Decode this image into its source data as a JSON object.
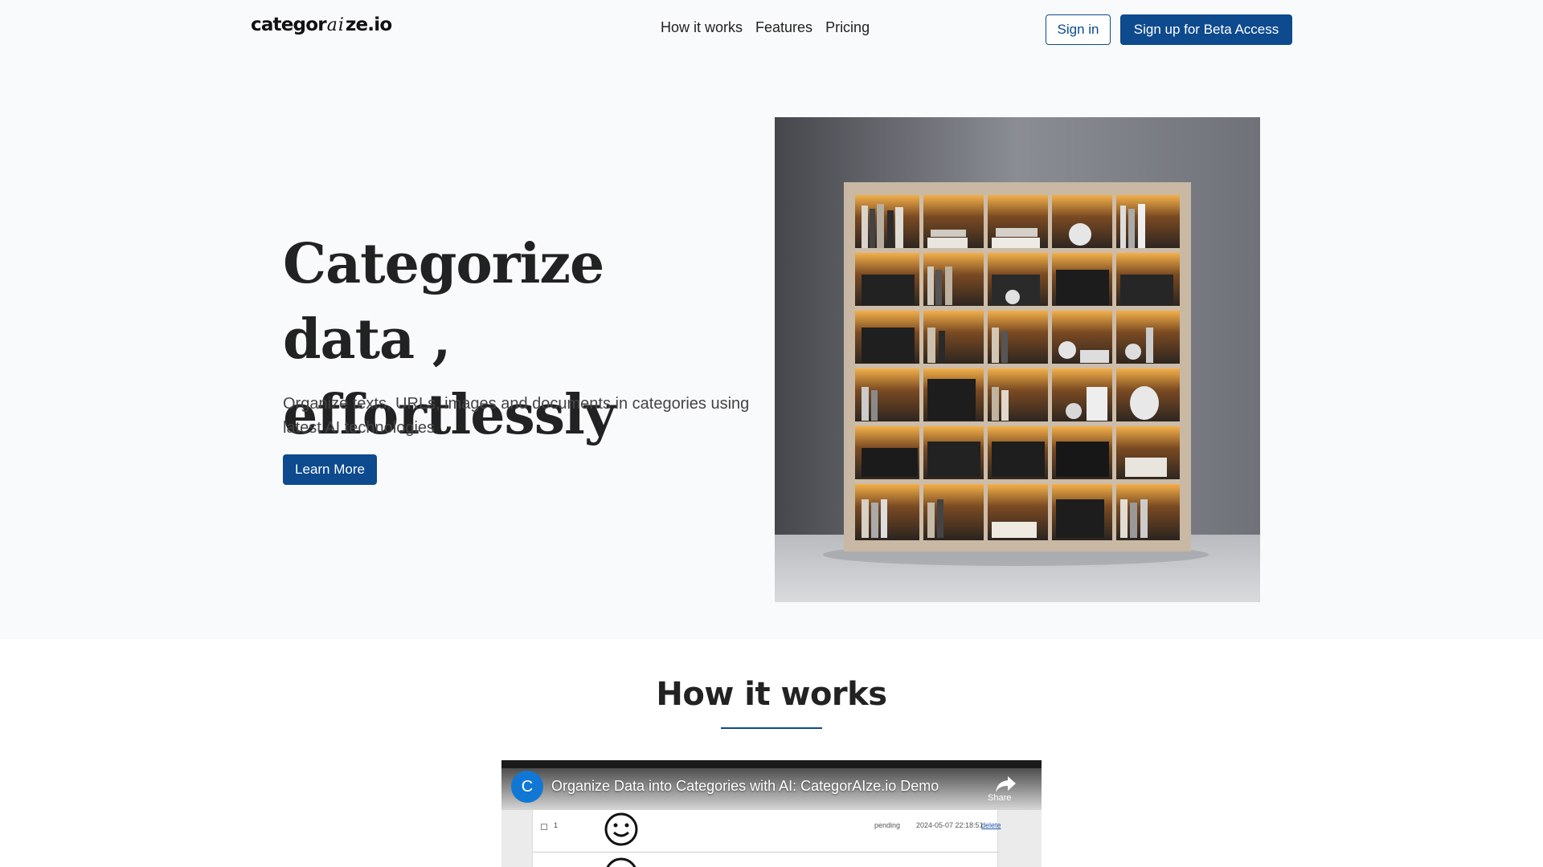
{
  "header": {
    "logo": {
      "prefix": "categor",
      "ai": "ai",
      "suffix": "ze.io"
    },
    "nav": [
      {
        "label": "How it works"
      },
      {
        "label": "Features"
      },
      {
        "label": "Pricing"
      }
    ],
    "signin_label": "Sign in",
    "signup_label": "Sign up for Beta Access"
  },
  "hero": {
    "title": "Categorize data , effortlessly",
    "subtitle": "Organize texts, URLs, images and documents in categories using latest AI technologies",
    "learn_more_label": "Learn More"
  },
  "how_it_works": {
    "title": "How it works",
    "video": {
      "channel_initial": "C",
      "title": "Organize Data into Categories with AI: CategorAIze.io Demo",
      "share_label": "Share",
      "row": {
        "number": "1",
        "status": "pending",
        "date": "2024-05-07 22:18:51",
        "action": "delete"
      }
    }
  },
  "colors": {
    "primary": "#0d4a8e",
    "hero_background": "#f9fafc",
    "video_avatar": "#1177d4"
  },
  "icons": [
    "share-icon",
    "smiley-icon"
  ]
}
